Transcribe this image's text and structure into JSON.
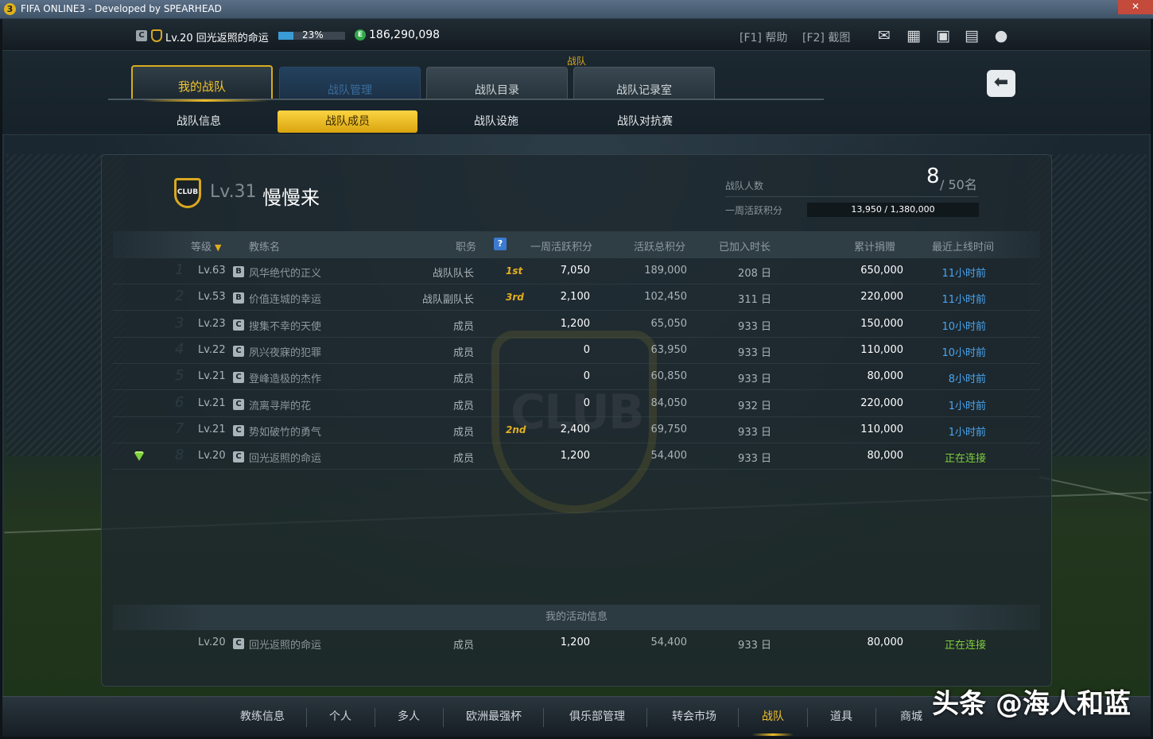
{
  "window": {
    "title": "FIFA ONLINE3 - Developed by SPEARHEAD",
    "app_icon": "3",
    "close_label": "✕"
  },
  "topbar": {
    "level": "Lv.20",
    "player_name": "回光返照的命运",
    "exp_percent": "23%",
    "exp_fraction": 0.23,
    "coins": "186,290,098",
    "coin_icon": "E",
    "badge_c": "C",
    "hotkeys": [
      "[F1] 帮助",
      "[F2] 截图"
    ],
    "icons": [
      "mail-icon",
      "grid-icon",
      "calendar-icon",
      "chat-icon",
      "profile-icon"
    ]
  },
  "header": {
    "section_title": "战队",
    "tabs": [
      {
        "label": "我的战队",
        "state": "active"
      },
      {
        "label": "战队管理",
        "state": "disabled"
      },
      {
        "label": "战队目录",
        "state": "normal"
      },
      {
        "label": "战队记录室",
        "state": "normal"
      }
    ],
    "subtabs": [
      {
        "label": "战队信息",
        "active": false
      },
      {
        "label": "战队成员",
        "active": true
      },
      {
        "label": "战队设施",
        "active": false
      },
      {
        "label": "战队对抗赛",
        "active": false
      }
    ]
  },
  "club": {
    "crest_text": "CLUB",
    "level": "Lv.31",
    "name": "慢慢来",
    "members_label": "战队人数",
    "members_now": "8",
    "members_max": "/ 50名",
    "weekly_label": "一周活跃积分",
    "weekly_value": "13,950 / 1,380,000",
    "watermark_text": "CLUB"
  },
  "table": {
    "headers": {
      "level": "等级",
      "name": "教练名",
      "role": "职务",
      "help": "?",
      "weekly": "一周活跃积分",
      "total": "活跃总积分",
      "joined": "已加入时长",
      "donated": "累计捐赠",
      "last_online": "最近上线时间"
    },
    "sort_arrow": "▼",
    "rows": [
      {
        "rank": "1",
        "level": "Lv.63",
        "badge": "B",
        "name": "风华绝代的正义",
        "role": "战队队长",
        "medal": "1st",
        "weekly": "7,050",
        "total": "189,000",
        "joined": "208 日",
        "donated": "650,000",
        "last_online": "11小时前",
        "connected": false
      },
      {
        "rank": "2",
        "level": "Lv.53",
        "badge": "B",
        "name": "价值连城的幸运",
        "role": "战队副队长",
        "medal": "3rd",
        "weekly": "2,100",
        "total": "102,450",
        "joined": "311 日",
        "donated": "220,000",
        "last_online": "11小时前",
        "connected": false
      },
      {
        "rank": "3",
        "level": "Lv.23",
        "badge": "C",
        "name": "搜集不幸的天使",
        "role": "成员",
        "medal": "",
        "weekly": "1,200",
        "total": "65,050",
        "joined": "933 日",
        "donated": "150,000",
        "last_online": "10小时前",
        "connected": false
      },
      {
        "rank": "4",
        "level": "Lv.22",
        "badge": "C",
        "name": "夙兴夜寐的犯罪",
        "role": "成员",
        "medal": "",
        "weekly": "0",
        "total": "63,950",
        "joined": "933 日",
        "donated": "110,000",
        "last_online": "10小时前",
        "connected": false
      },
      {
        "rank": "5",
        "level": "Lv.21",
        "badge": "C",
        "name": "登峰造极的杰作",
        "role": "成员",
        "medal": "",
        "weekly": "0",
        "total": "60,850",
        "joined": "933 日",
        "donated": "80,000",
        "last_online": "8小时前",
        "connected": false
      },
      {
        "rank": "6",
        "level": "Lv.21",
        "badge": "C",
        "name": "流离寻岸的花",
        "role": "成员",
        "medal": "",
        "weekly": "0",
        "total": "84,050",
        "joined": "932 日",
        "donated": "220,000",
        "last_online": "1小时前",
        "connected": false
      },
      {
        "rank": "7",
        "level": "Lv.21",
        "badge": "C",
        "name": "势如破竹的勇气",
        "role": "成员",
        "medal": "2nd",
        "weekly": "2,400",
        "total": "69,750",
        "joined": "933 日",
        "donated": "110,000",
        "last_online": "1小时前",
        "connected": false
      },
      {
        "rank": "8",
        "level": "Lv.20",
        "badge": "C",
        "name": "回光返照的命运",
        "role": "成员",
        "medal": "",
        "weekly": "1,200",
        "total": "54,400",
        "joined": "933 日",
        "donated": "80,000",
        "last_online": "正在连接",
        "connected": true,
        "is_me": true
      }
    ]
  },
  "my_activity": {
    "title": "我的活动信息",
    "row": {
      "level": "Lv.20",
      "badge": "C",
      "name": "回光返照的命运",
      "role": "成员",
      "weekly": "1,200",
      "total": "54,400",
      "joined": "933 日",
      "donated": "80,000",
      "last_online": "正在连接"
    }
  },
  "bottom_nav": [
    {
      "label": "教练信息",
      "active": false
    },
    {
      "label": "个人",
      "active": false
    },
    {
      "label": "多人",
      "active": false
    },
    {
      "label": "欧洲最强杯",
      "active": false
    },
    {
      "label": "俱乐部管理",
      "active": false
    },
    {
      "label": "转会市场",
      "active": false
    },
    {
      "label": "战队",
      "active": true
    },
    {
      "label": "道具",
      "active": false
    },
    {
      "label": "商城",
      "active": false
    }
  ],
  "source_watermark": "头条 @海人和蓝",
  "colors": {
    "accent_gold": "#f0be28",
    "online_blue": "#4aa4f0",
    "connected_green": "#7fcd3d"
  }
}
